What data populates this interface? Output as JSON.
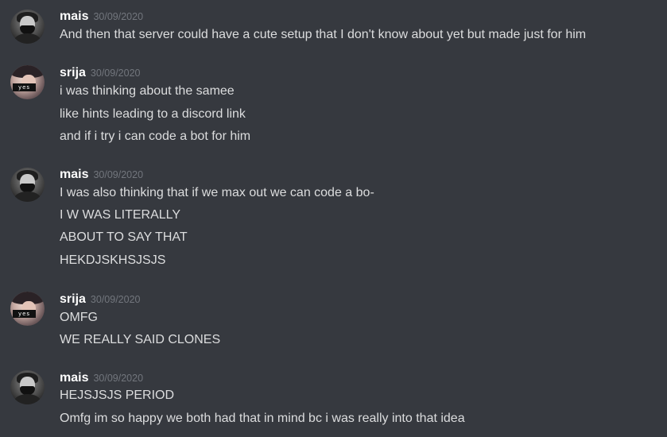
{
  "messages": [
    {
      "author": "mais",
      "timestamp": "30/09/2020",
      "lines": [
        "And then that server could have a cute setup that I don't know about yet but made just for him"
      ]
    },
    {
      "author": "srija",
      "timestamp": "30/09/2020",
      "avatar_badge": "yes",
      "lines": [
        "i was thinking about the samee",
        "like hints leading to a discord link",
        "and if i try i can code a bot for him"
      ]
    },
    {
      "author": "mais",
      "timestamp": "30/09/2020",
      "lines": [
        "I was also thinking that if we max out we can code a bo-",
        "I W WAS LITERALLY",
        "ABOUT TO SAY THAT",
        "HEKDJSKHSJSJS"
      ]
    },
    {
      "author": "srija",
      "timestamp": "30/09/2020",
      "avatar_badge": "yes",
      "lines": [
        "OMFG",
        "WE REALLY SAID CLONES"
      ]
    },
    {
      "author": "mais",
      "timestamp": "30/09/2020",
      "lines": [
        "HEJSJSJS PERIOD",
        "Omfg im so happy we both had that in mind bc i was really into that idea"
      ]
    }
  ]
}
